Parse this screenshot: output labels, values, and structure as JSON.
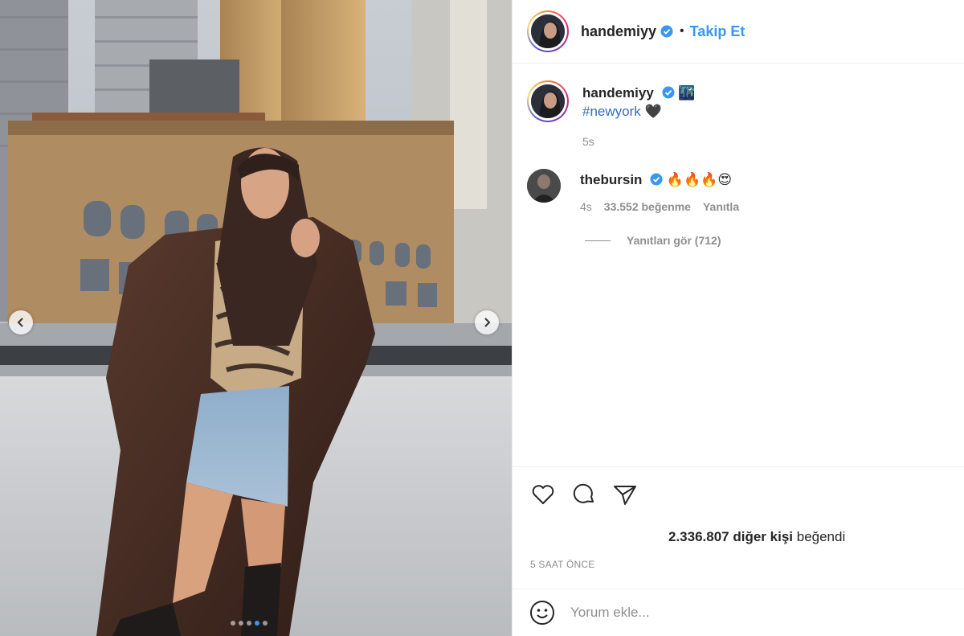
{
  "post": {
    "author": "handemiyy",
    "separator": "•",
    "follow_label": "Takip Et"
  },
  "caption": {
    "username": "handemiyy",
    "emoji": "🌃",
    "hashtag": "#newyork",
    "heart": "🖤",
    "age": "5s"
  },
  "comment": {
    "username": "thebursin",
    "text": "🔥🔥🔥😍",
    "age": "4s",
    "likes": "33.552 beğenme",
    "reply_label": "Yanıtla",
    "view_replies": "Yanıtları gör (712)"
  },
  "engagement": {
    "likes_count": "2.336.807 diğer kişi",
    "likes_suffix": "beğendi",
    "timestamp": "5 SAAT ÖNCE"
  },
  "composer": {
    "placeholder": "Yorum ekle..."
  },
  "carousel": {
    "slides": 5,
    "active": 4
  },
  "colors": {
    "link": "#3897f0",
    "verified": "#3897f0",
    "muted": "#8e8e8e"
  }
}
